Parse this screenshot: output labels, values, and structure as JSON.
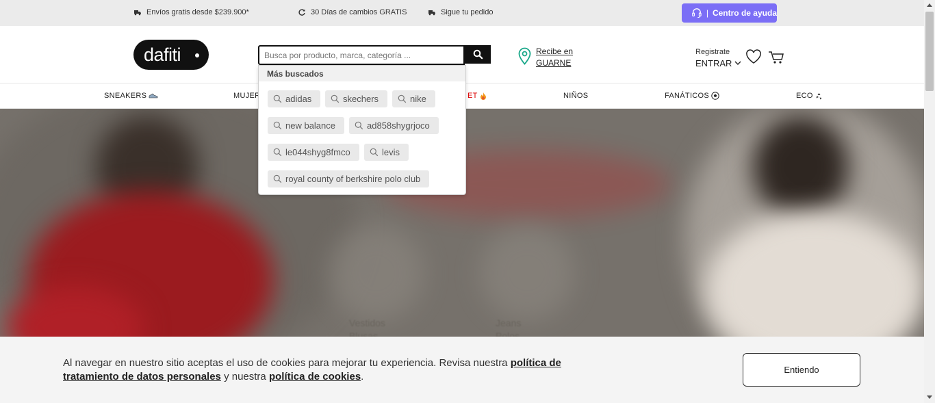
{
  "topbar": {
    "promos": [
      {
        "label": "Envíos gratis desde $239.900*",
        "icon": "truck-icon"
      },
      {
        "label": "30 Días de cambios GRATIS",
        "icon": "refresh-icon"
      },
      {
        "label": "Sigue tu pedido",
        "icon": "truck-icon"
      }
    ],
    "help": {
      "separator": "|",
      "label": "Centro de ayuda",
      "icon": "headset-icon"
    }
  },
  "header": {
    "logo": "dafiti",
    "search_placeholder": "Busca por producto, marca, categoría ...",
    "location": {
      "line1": "Recibe en",
      "line2": "GUARNE"
    },
    "account": {
      "register": "Registrate",
      "login": "ENTRAR"
    }
  },
  "nav": {
    "items": [
      {
        "label": "SNEAKERS",
        "icon": "sneaker-icon"
      },
      {
        "label": "MUJER"
      },
      {
        "label": "ET",
        "icon": "fire-icon"
      },
      {
        "label": "NIÑOS"
      },
      {
        "label": "FANÁTICOS",
        "icon": "soccer-ball-icon"
      },
      {
        "label": "ECO",
        "icon": "recycle-icon"
      }
    ]
  },
  "search_dropdown": {
    "heading": "Más buscados",
    "suggestions": [
      "adidas",
      "skechers",
      "nike",
      "new balance",
      "ad858shygrjoco",
      "le044shyg8fmco",
      "levis",
      "royal county of berkshire polo club"
    ]
  },
  "hero": {
    "categories_left": [
      "Vestidos",
      "Blusas"
    ],
    "categories_right": [
      "Jeans",
      "Polos"
    ]
  },
  "cookie_banner": {
    "text_1": "Al navegar en nuestro sitio aceptas el uso de cookies para mejorar tu experiencia. Revisa nuestra ",
    "link_1": "política de tratamiento de datos personales",
    "text_2": " y nuestra ",
    "link_2": "política de cookies",
    "text_3": ".",
    "button": "Entiendo"
  },
  "colors": {
    "help_button": "#7b6ef6",
    "outlet": "#dd0000",
    "location_pin": "#1aa88a"
  }
}
